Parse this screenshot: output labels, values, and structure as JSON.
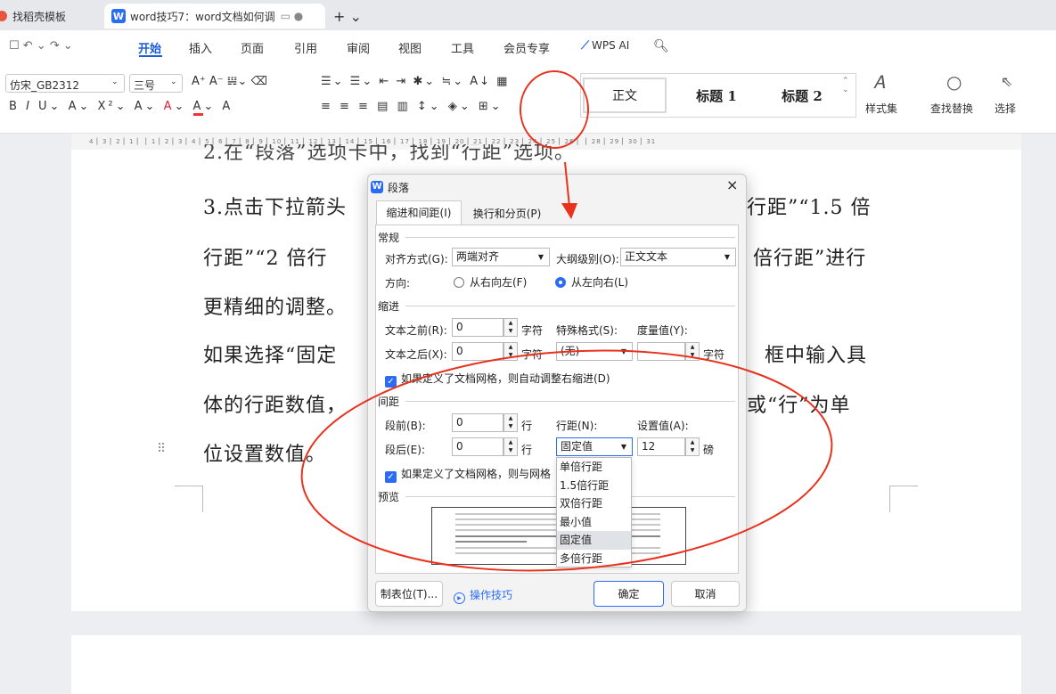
{
  "tabs": [
    {
      "label": "找稻壳模板"
    },
    {
      "label": "word技巧7：word文档如何调",
      "icon_letter": "W"
    }
  ],
  "new_tab": "+ ⌄",
  "menu": {
    "items": [
      "开始",
      "插入",
      "页面",
      "引用",
      "审阅",
      "视图",
      "工具",
      "会员专享"
    ],
    "ai": "WPS AI"
  },
  "ribbon": {
    "font_name": "仿宋_GB2312",
    "font_size": "三号",
    "styles": [
      "正文",
      "标题 1",
      "标题 2"
    ],
    "style_set": "样式集",
    "find_replace": "查找替换",
    "select": "选择",
    "row2": [
      "B",
      "I",
      "U",
      "A",
      "X²",
      "A",
      "A",
      "A"
    ]
  },
  "ruler": "4 ▏3 ▏2 ▏1 ▏ ▏1 ▏2 ▏3 ▏4 ▏5 ▏6 ▏7 ▏8 ▏9 ▏10 ▏11 ▏12 ▏13 ▏14 ▏15 ▏16 ▏17 ▏18 ▏19 ▏20 ▏21 ▏22 ▏23 ▏24 ▏25 ▏26 ▏ ▏28 ▏29 ▏30 ▏31",
  "doc": {
    "lines": [
      "2.在“段落”选项卡中，找到“行距”选项。",
      "3.点击下拉箭头",
      "行距”“2 倍行",
      "更精细的调整。",
      "如果选择“固定",
      "体的行距数值，",
      "位设置数值。"
    ],
    "right_lines": [
      "行距”“1.5 倍",
      "倍行距”进行",
      "框中输入具",
      "或“行”为单"
    ]
  },
  "dialog": {
    "title": "段落",
    "close": "×",
    "tabs": [
      "缩进和间距(I)",
      "换行和分页(P)"
    ],
    "general": {
      "heading": "常规",
      "align_label": "对齐方式(G):",
      "align_value": "两端对齐",
      "outline_label": "大纲级别(O):",
      "outline_value": "正文文本",
      "direction_label": "方向:",
      "rtl": "从右向左(F)",
      "ltr": "从左向右(L)"
    },
    "indent": {
      "heading": "缩进",
      "before_label": "文本之前(R):",
      "before_value": "0",
      "unit": "字符",
      "special_label": "特殊格式(S):",
      "measure_label": "度量值(Y):",
      "after_label": "文本之后(X):",
      "after_value": "0",
      "special_value": "(无)",
      "unit2": "字符",
      "auto_adjust": "如果定义了文档网格，则自动调整右缩进(D)"
    },
    "spacing": {
      "heading": "间距",
      "before_label": "段前(B):",
      "before_value": "0",
      "unit": "行",
      "line_label": "行距(N):",
      "set_label": "设置值(A):",
      "after_label": "段后(E):",
      "after_value": "0",
      "line_value": "固定值",
      "set_value": "12",
      "set_unit": "磅",
      "grid_align": "如果定义了文档网格，则与网格"
    },
    "preview_label": "预览",
    "line_options": [
      "单倍行距",
      "1.5倍行距",
      "双倍行距",
      "最小值",
      "固定值",
      "多倍行距"
    ],
    "selected_option": "固定值",
    "buttons": {
      "tabs": "制表位(T)...",
      "tips": "操作技巧",
      "ok": "确定",
      "cancel": "取消"
    }
  },
  "colors": {
    "accent": "#2b6cf6",
    "annotation": "#e8321e"
  }
}
